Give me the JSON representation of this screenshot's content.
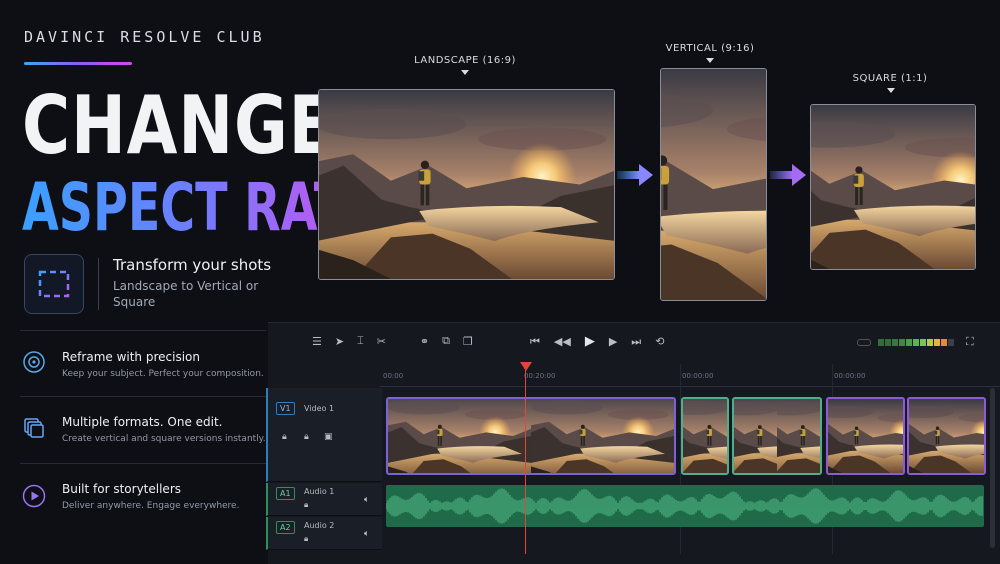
{
  "brand": "DAVINCI RESOLVE CLUB",
  "title_line1": "CHANGE",
  "title_line2": "ASPECT RATIO",
  "tagline": {
    "heading": "Transform your shots",
    "subtitle": "Landscape to Vertical or Square"
  },
  "features": [
    {
      "icon": "target-icon",
      "title": "Reframe with precision",
      "subtitle": "Keep your subject. Perfect your composition."
    },
    {
      "icon": "layers-icon",
      "title": "Multiple formats. One edit.",
      "subtitle": "Create vertical and square versions instantly."
    },
    {
      "icon": "play-circle-icon",
      "title": "Built for storytellers",
      "subtitle": "Deliver anywhere. Engage everywhere."
    }
  ],
  "previews": [
    {
      "label": "LANDSCAPE (16:9)"
    },
    {
      "label": "VERTICAL (9:16)"
    },
    {
      "label": "SQUARE (1:1)"
    }
  ],
  "timeline": {
    "ruler": [
      "00:00",
      "00:20:00",
      "00:00:00",
      "00:00:00"
    ],
    "tracks": [
      {
        "badge": "V1",
        "name": "Video 1"
      },
      {
        "badge": "A1",
        "name": "Audio 1"
      },
      {
        "badge": "A2",
        "name": "Audio 2"
      }
    ]
  },
  "colors": {
    "accent_blue": "#3aa0ff",
    "accent_purple": "#b65cf2",
    "clip_purple": "#7a63d8",
    "clip_green": "#4fae8c",
    "audio_green": "#2f8f5c",
    "playhead": "#e0463c"
  }
}
